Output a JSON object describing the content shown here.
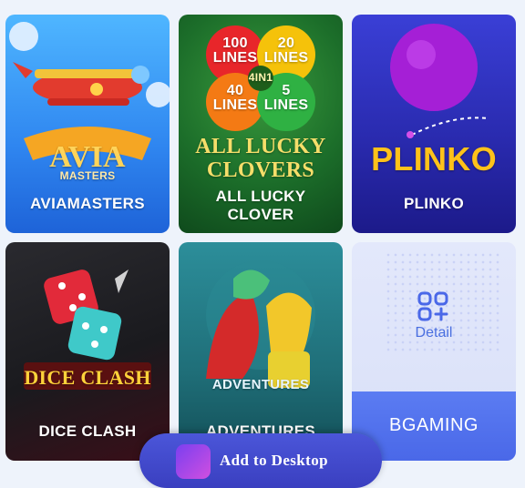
{
  "games": [
    {
      "name": "AVIAMASTERS",
      "logo_lines": [
        "AVIA",
        "MASTERS"
      ]
    },
    {
      "name_lines": [
        "ALL LUCKY",
        "CLOVER"
      ],
      "logo_lines": [
        "ALL LUCKY",
        "CLOVERS"
      ],
      "badges": [
        "100\nLINES",
        "20\nLINES",
        "40\nLINES",
        "5\nLINES"
      ],
      "center_badge": "4IN1"
    },
    {
      "name": "PLINKO",
      "logo": "PLINKO"
    },
    {
      "name": "DICE CLASH",
      "logo": "DICE CLASH"
    },
    {
      "name": "ADVENTURES",
      "logo": "ADVENTURES"
    }
  ],
  "detail_tile": {
    "label": "Detail",
    "provider": "BGAMING",
    "icon": "grid-apps-icon"
  },
  "add_to_desktop": {
    "label": "Add to Desktop",
    "icon": "app-logo-icon"
  },
  "colors": {
    "accent": "#4a68e8",
    "pill": "#3a3fc0",
    "page_bg": "#eef3fb"
  }
}
